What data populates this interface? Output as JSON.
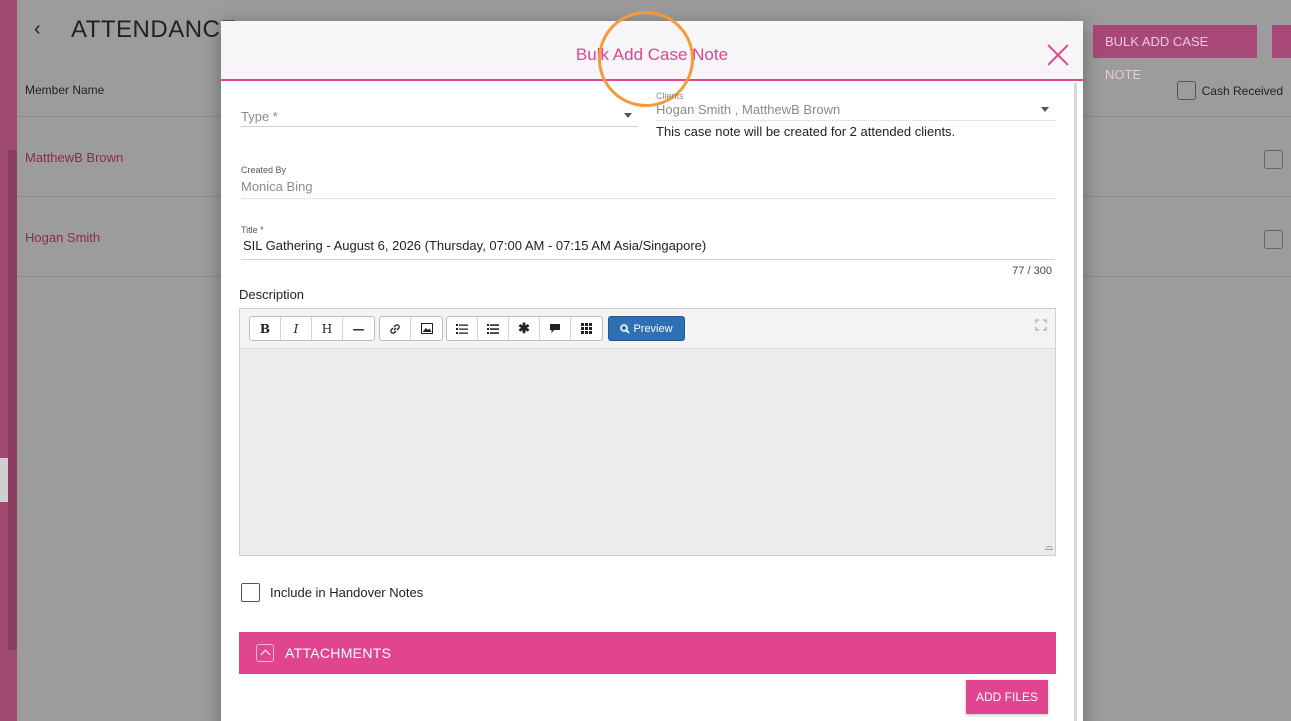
{
  "background": {
    "page_title": "ATTENDANCE",
    "back_icon": "chevron-left-icon",
    "bulk_add_button": "BULK ADD CASE NOTE",
    "columns": {
      "member_name": "Member Name",
      "cash_received": "Cash Received"
    },
    "rows": [
      {
        "name": "MatthewB Brown"
      },
      {
        "name": "Hogan Smith"
      }
    ]
  },
  "modal": {
    "title": "Bulk Add Case Note",
    "close_icon": "close-icon",
    "type": {
      "label": "Type *"
    },
    "clients": {
      "label": "Clients",
      "value": "Hogan Smith , MatthewB Brown",
      "note": "This case note will be created for 2 attended clients."
    },
    "created_by": {
      "label": "Created By",
      "value": "Monica Bing"
    },
    "title_field": {
      "label": "Title *",
      "value": "SIL Gathering - August 6, 2026 (Thursday, 07:00 AM - 07:15 AM Asia/Singapore)",
      "counter": "77 / 300"
    },
    "description": {
      "label": "Description",
      "toolbar": {
        "bold": "B",
        "italic": "I",
        "heading": "H",
        "rule": "—",
        "preview": "Preview"
      }
    },
    "handover": {
      "label": "Include in Handover Notes",
      "checked": false
    },
    "attachments": {
      "label": "ATTACHMENTS",
      "add_files": "ADD FILES"
    }
  },
  "colors": {
    "accent": "#e2458f",
    "preview_button": "#2f6fb3",
    "focus_ring": "#f59a3c"
  }
}
